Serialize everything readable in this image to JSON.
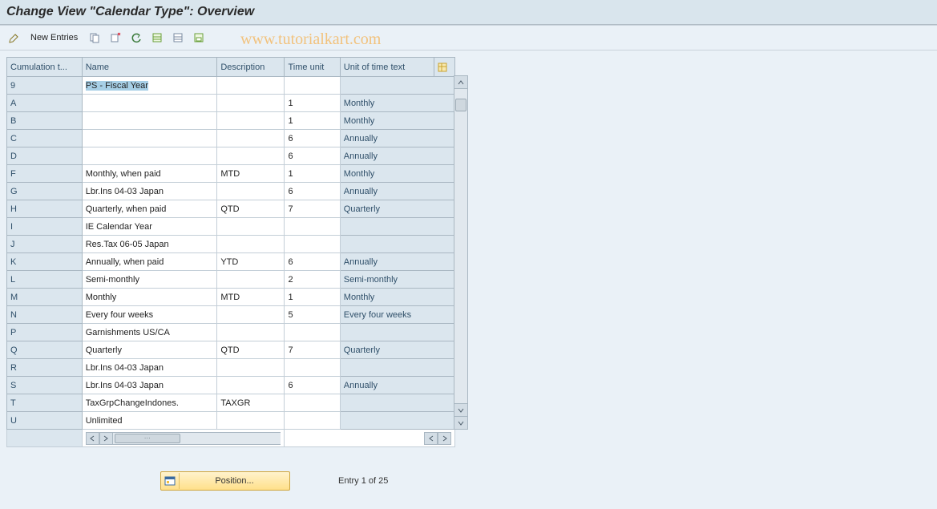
{
  "title": "Change View \"Calendar Type\": Overview",
  "watermark": "www.tutorialkart.com",
  "toolbar": {
    "new_entries": "New Entries"
  },
  "columns": {
    "cumulation": "Cumulation t...",
    "name": "Name",
    "description": "Description",
    "time_unit": "Time unit",
    "unit_of_time_text": "Unit of time text"
  },
  "rows": [
    {
      "ct": "9",
      "name": "PS - Fiscal Year",
      "desc": "",
      "tu": "",
      "uot": "",
      "selected": true
    },
    {
      "ct": "A",
      "name": "",
      "desc": "",
      "tu": "1",
      "uot": "Monthly"
    },
    {
      "ct": "B",
      "name": "",
      "desc": "",
      "tu": "1",
      "uot": "Monthly"
    },
    {
      "ct": "C",
      "name": "",
      "desc": "",
      "tu": "6",
      "uot": "Annually"
    },
    {
      "ct": "D",
      "name": "",
      "desc": "",
      "tu": "6",
      "uot": "Annually"
    },
    {
      "ct": "F",
      "name": "Monthly, when paid",
      "desc": "MTD",
      "tu": "1",
      "uot": "Monthly"
    },
    {
      "ct": "G",
      "name": "Lbr.Ins 04-03  Japan",
      "desc": "",
      "tu": "6",
      "uot": "Annually"
    },
    {
      "ct": "H",
      "name": "Quarterly, when paid",
      "desc": "QTD",
      "tu": "7",
      "uot": "Quarterly"
    },
    {
      "ct": "I",
      "name": "IE Calendar Year",
      "desc": "",
      "tu": "",
      "uot": ""
    },
    {
      "ct": "J",
      "name": "Res.Tax 06-05  Japan",
      "desc": "",
      "tu": "",
      "uot": ""
    },
    {
      "ct": "K",
      "name": "Annually, when paid",
      "desc": "YTD",
      "tu": "6",
      "uot": "Annually"
    },
    {
      "ct": "L",
      "name": "Semi-monthly",
      "desc": "",
      "tu": "2",
      "uot": "Semi-monthly"
    },
    {
      "ct": "M",
      "name": "Monthly",
      "desc": "MTD",
      "tu": "1",
      "uot": "Monthly"
    },
    {
      "ct": "N",
      "name": "Every four weeks",
      "desc": "",
      "tu": "5",
      "uot": "Every four weeks"
    },
    {
      "ct": "P",
      "name": "Garnishments US/CA",
      "desc": "",
      "tu": "",
      "uot": ""
    },
    {
      "ct": "Q",
      "name": "Quarterly",
      "desc": "QTD",
      "tu": "7",
      "uot": "Quarterly"
    },
    {
      "ct": "R",
      "name": "Lbr.Ins 04-03  Japan",
      "desc": "",
      "tu": "",
      "uot": ""
    },
    {
      "ct": "S",
      "name": "Lbr.Ins 04-03  Japan",
      "desc": "",
      "tu": "6",
      "uot": "Annually"
    },
    {
      "ct": "T",
      "name": "TaxGrpChangeIndones.",
      "desc": "TAXGR",
      "tu": "",
      "uot": ""
    },
    {
      "ct": "U",
      "name": "Unlimited",
      "desc": "",
      "tu": "",
      "uot": ""
    }
  ],
  "footer": {
    "position_label": "Position...",
    "entry_text": "Entry 1 of 25"
  }
}
